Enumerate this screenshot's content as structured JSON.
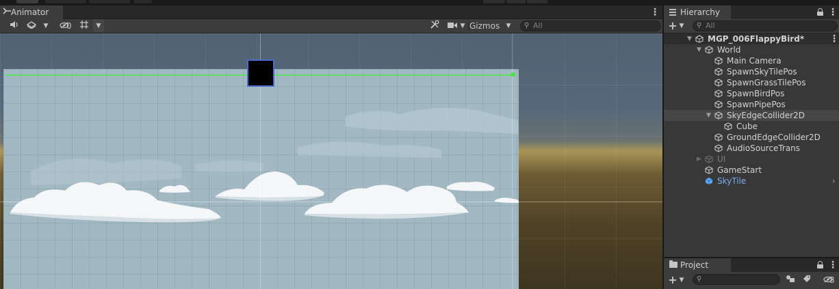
{
  "animator": {
    "tab_label": "Animator",
    "toolbar": {
      "hidden_count": "0",
      "gizmos_label": "Gizmos",
      "search_placeholder": "All"
    }
  },
  "hierarchy": {
    "tab_label": "Hierarchy",
    "search_placeholder": "All",
    "items": [
      {
        "label": "MGP_006FlappyBird*",
        "depth": 0,
        "kind": "scene"
      },
      {
        "label": "World",
        "depth": 1,
        "kind": "normal"
      },
      {
        "label": "Main Camera",
        "depth": 2,
        "kind": "normal"
      },
      {
        "label": "SpawnSkyTilePos",
        "depth": 2,
        "kind": "normal"
      },
      {
        "label": "SpawnGrassTilePos",
        "depth": 2,
        "kind": "normal"
      },
      {
        "label": "SpawnBirdPos",
        "depth": 2,
        "kind": "normal"
      },
      {
        "label": "SpawnPipePos",
        "depth": 2,
        "kind": "normal"
      },
      {
        "label": "SkyEdgeCollider2D",
        "depth": 2,
        "kind": "selected"
      },
      {
        "label": "Cube",
        "depth": 3,
        "kind": "normal"
      },
      {
        "label": "GroundEdgeCollider2D",
        "depth": 2,
        "kind": "normal"
      },
      {
        "label": "AudioSourceTrans",
        "depth": 2,
        "kind": "normal"
      },
      {
        "label": "UI",
        "depth": 1,
        "kind": "disabled"
      },
      {
        "label": "GameStart",
        "depth": 1,
        "kind": "normal"
      },
      {
        "label": "SkyTile",
        "depth": 1,
        "kind": "prefab"
      }
    ]
  },
  "project": {
    "tab_label": "Project",
    "hidden_count": "8"
  },
  "colors": {
    "collider_line": "#5fe15f",
    "selection_outline": "#4c6ad0",
    "prefab_text": "#7bacf1",
    "sky_fill": "#a2b9c3"
  },
  "icons": {
    "animator_tab": "animator-icon",
    "hierarchy_tab": "hierarchy-lines-icon",
    "project_tab": "folder-icon",
    "gameobject": "cube-icon",
    "scene": "unity-scene-icon"
  }
}
